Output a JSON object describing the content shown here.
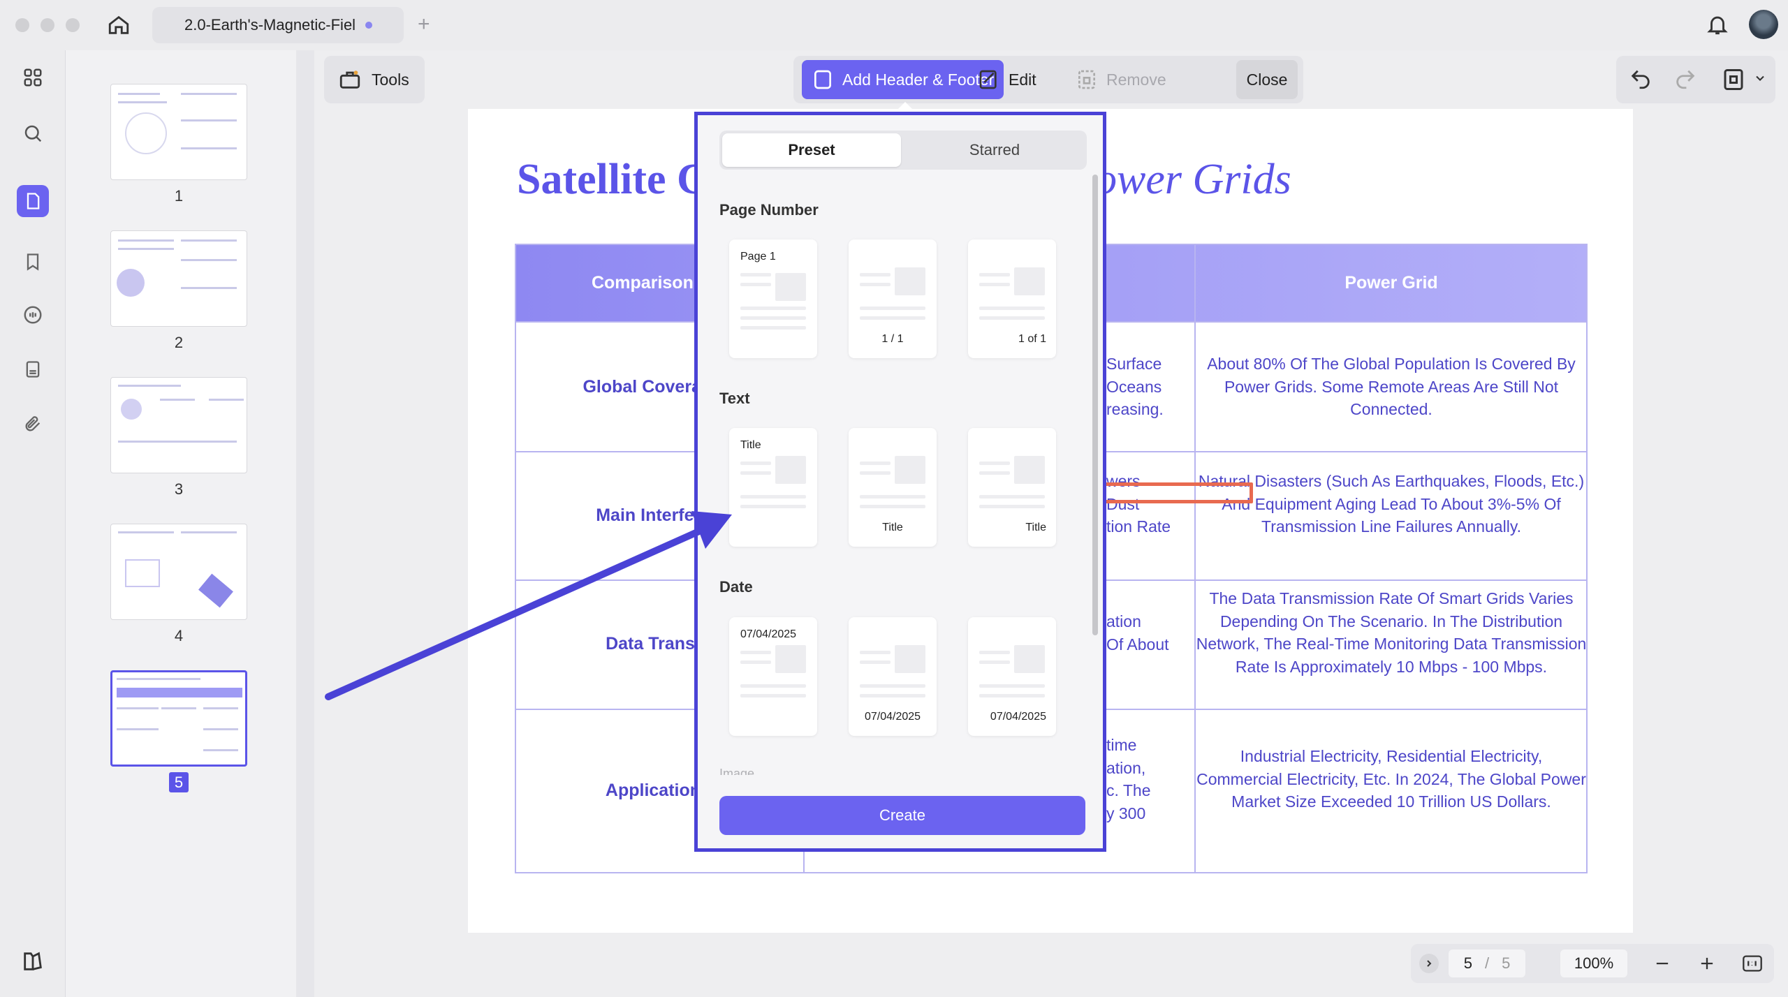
{
  "window": {
    "tab_title": "2.0-Earth's-Magnetic-Fiel",
    "tab_add": "+"
  },
  "toolbar": {
    "tools_label": "Tools",
    "add_header_footer_label": "Add Header & Footer",
    "edit_label": "Edit",
    "remove_label": "Remove",
    "close_label": "Close"
  },
  "thumbnails": [
    {
      "label": "1"
    },
    {
      "label": "2"
    },
    {
      "label": "3"
    },
    {
      "label": "4"
    },
    {
      "label": "5",
      "active": true
    }
  ],
  "document": {
    "title_left": "Satellite C",
    "title_right": "ower Grids",
    "headers": {
      "col1": "Comparison Dim",
      "col3": "Power Grid"
    },
    "rows": [
      {
        "label": "Global Coverage(A",
        "mid": [
          "Surface",
          "Oceans",
          "reasing."
        ],
        "grid": "About 80% Of The Global Population Is Covered By Power Grids. Some Remote Areas Are Still Not Connected."
      },
      {
        "label": "Main Interfering",
        "mid": [
          "wers",
          "Dust",
          "tion Rate"
        ],
        "grid": "Natural Disasters (Such As Earthquakes, Floods, Etc.) And Equipment Aging Lead To About 3%-5% Of Transmission Line Failures Annually."
      },
      {
        "label": "Data Transfer",
        "mid": [
          "ation",
          "Of About"
        ],
        "grid": "The Data Transmission Rate Of Smart Grids Varies Depending On The Scenario. In The Distribution Network, The Real-Time Monitoring Data Transmission Rate Is Approximately 10 Mbps - 100 Mbps."
      },
      {
        "label": "Application A",
        "mid": [
          "time",
          "ation,",
          "c. The",
          "y 300"
        ],
        "grid": "Industrial Electricity, Residential Electricity, Commercial Electricity, Etc. In 2024, The Global Power Market Size Exceeded 10 Trillion US Dollars."
      }
    ]
  },
  "panel": {
    "tab_preset": "Preset",
    "tab_starred": "Starred",
    "section_page_number": "Page Number",
    "section_text": "Text",
    "section_date": "Date",
    "section_more": "Image",
    "page_number_cards": [
      "Page 1",
      "1 / 1",
      "1 of 1"
    ],
    "text_cards": [
      "Title",
      "Title",
      "Title"
    ],
    "date_cards": [
      "07/04/2025",
      "07/04/2025",
      "07/04/2025"
    ],
    "create_label": "Create"
  },
  "pager": {
    "current": "5",
    "separator": "/",
    "total": "5",
    "zoom": "100%"
  },
  "colors": {
    "accent": "#6b63f0",
    "panel_border": "#4a42d6",
    "arrow": "#4a42d6",
    "highlight": "#e86a50",
    "doc_text": "#4d46c8"
  }
}
